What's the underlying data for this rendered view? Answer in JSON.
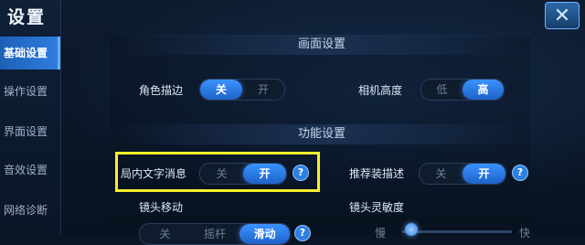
{
  "window": {
    "title": "设置",
    "close_icon": "close-icon"
  },
  "sidebar": {
    "items": [
      {
        "label": "基础设置",
        "active": true
      },
      {
        "label": "操作设置",
        "active": false
      },
      {
        "label": "界面设置",
        "active": false
      },
      {
        "label": "音效设置",
        "active": false
      },
      {
        "label": "网络诊断",
        "active": false
      }
    ]
  },
  "sections": {
    "display": "画面设置",
    "function": "功能设置"
  },
  "settings": {
    "outline": {
      "label": "角色描边",
      "options": [
        "关",
        "开"
      ],
      "selected": "关"
    },
    "camera_height": {
      "label": "相机高度",
      "options": [
        "低",
        "高"
      ],
      "selected": "高"
    },
    "in_game_text": {
      "label": "局内文字消息",
      "options": [
        "关",
        "开"
      ],
      "selected": "开"
    },
    "recommended_desc": {
      "label": "推荐装描述",
      "options": [
        "关",
        "开"
      ],
      "selected": "开"
    },
    "camera_move": {
      "label": "镜头移动",
      "options": [
        "关",
        "摇杆",
        "滑动"
      ],
      "selected": "滑动"
    },
    "camera_sensitivity": {
      "label": "镜头灵敏度",
      "min_label": "慢",
      "max_label": "快"
    }
  },
  "help_glyph": "?",
  "colors": {
    "accent": "#2f7fe0",
    "highlight": "#f5f02a",
    "background": "#0a1626"
  }
}
